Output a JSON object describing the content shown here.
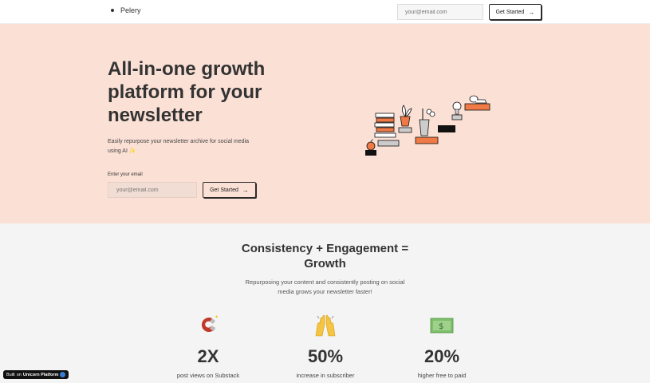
{
  "nav": {
    "brand": "Pelery",
    "email_placeholder": "your@email.com",
    "cta": "Get Started",
    "cta_arrow": "→"
  },
  "hero": {
    "title": "All-in-one growth platform for your newsletter",
    "subtitle": "Easily repurpose your newsletter archive for social media using AI ✨",
    "email_label": "Enter your email",
    "email_placeholder": "your@email.com",
    "cta": "Get Started",
    "cta_arrow": "→",
    "bg_color": "#fbe0d5"
  },
  "section": {
    "title_line1": "Consistency + Engagement =",
    "title_line2": "Growth",
    "subtitle": "Repurposing your content and consistently posting on social media grows your newsletter faster!"
  },
  "stats": [
    {
      "icon": "magnet-icon",
      "value": "2X",
      "caption": "post views on Substack"
    },
    {
      "icon": "raising-hands-icon",
      "value": "50%",
      "caption": "increase in subscriber"
    },
    {
      "icon": "money-icon",
      "value": "20%",
      "caption": "higher free to paid"
    }
  ],
  "badge": {
    "prefix": "Built",
    "middle": "on",
    "suffix": "Unicorn Platform"
  },
  "colors": {
    "accent": "#f07a45",
    "hero_bg": "#fbe0d5",
    "section_bg": "#f4f4f4"
  }
}
